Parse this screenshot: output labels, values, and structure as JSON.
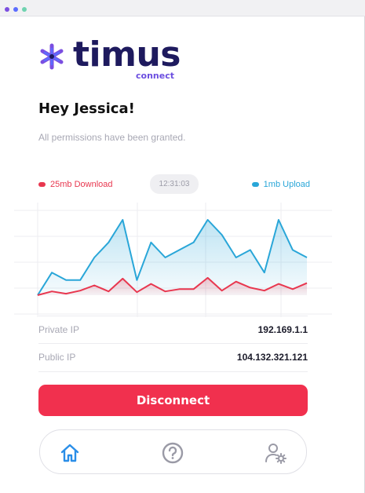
{
  "logo": {
    "wordmark": "timus",
    "sub": "connect"
  },
  "greeting": "Hey Jessica!",
  "permissions_text": "All permissions have been granted.",
  "legend": {
    "download": "25mb Download",
    "upload": "1mb Upload",
    "time": "12:31:03"
  },
  "colors": {
    "download": "#e8374f",
    "upload": "#29a6d8",
    "accent": "#f1304e",
    "brand": "#1e1a5e",
    "brand_sub": "#6b4ee0"
  },
  "chart_data": {
    "type": "area",
    "x": [
      0,
      1,
      2,
      3,
      4,
      5,
      6,
      7,
      8,
      9,
      10,
      11,
      12,
      13,
      14,
      15,
      16,
      17,
      18,
      19
    ],
    "series": [
      {
        "name": "1mb Upload",
        "values": [
          0,
          3,
          2,
          2,
          5,
          7,
          10,
          2,
          7,
          5,
          6,
          7,
          10,
          8,
          5,
          6,
          3,
          10,
          6,
          5
        ]
      },
      {
        "name": "25mb Download",
        "values": [
          0,
          0.5,
          0.2,
          0.6,
          1.3,
          0.5,
          2.2,
          0.4,
          1.5,
          0.5,
          0.8,
          0.8,
          2.3,
          0.6,
          1.8,
          1.0,
          0.6,
          1.5,
          0.8,
          1.6
        ]
      }
    ],
    "grid": true
  },
  "info": [
    {
      "label": "Private IP",
      "value": "192.169.1.1"
    },
    {
      "label": "Public IP",
      "value": "104.132.321.121"
    }
  ],
  "disconnect_label": "Disconnect",
  "nav": {
    "home_icon": "home-icon",
    "help_icon": "help-icon",
    "settings_icon": "user-settings-icon"
  }
}
